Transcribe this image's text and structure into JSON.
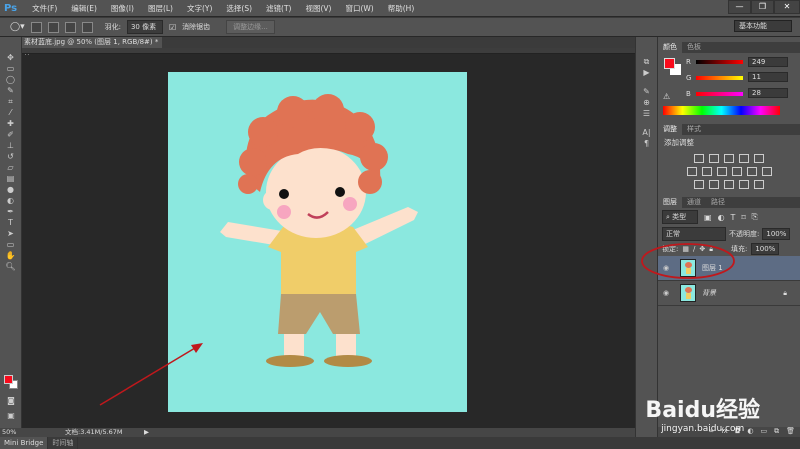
{
  "app": {
    "logo": "Ps"
  },
  "menu": [
    "文件(F)",
    "编辑(E)",
    "图像(I)",
    "图层(L)",
    "文字(Y)",
    "选择(S)",
    "滤镜(T)",
    "视图(V)",
    "窗口(W)",
    "帮助(H)"
  ],
  "window_controls": {
    "minimize": "—",
    "restore": "❐",
    "close": "✕"
  },
  "options": {
    "feather_label": "羽化:",
    "feather_value": "30 像素",
    "antialias_label": "消除锯齿",
    "antialias_checked": true,
    "refine_edge": "调整边缘...",
    "workspace": "基本功能"
  },
  "document": {
    "tab_title": "素材蓝底.jpg @ 50% (图层 1, RGB/8#) *",
    "close": "×"
  },
  "status": {
    "zoom": "50%",
    "doc_info": "文档:3.41M/5.67M"
  },
  "bottom_tabs": [
    "Mini Bridge",
    "时间轴"
  ],
  "color_panel": {
    "tabs": [
      "颜色",
      "色板"
    ],
    "foreground": "#f90b1c",
    "background": "#ffffff",
    "channels": [
      {
        "label": "R",
        "value": "249"
      },
      {
        "label": "G",
        "value": "11"
      },
      {
        "label": "B",
        "value": "28"
      }
    ]
  },
  "adjust_panel": {
    "tabs": [
      "调整",
      "样式"
    ],
    "title": "添加调整"
  },
  "layers_panel": {
    "tabs": [
      "图层",
      "通道",
      "路径"
    ],
    "filter": "类型",
    "blend_mode": "正常",
    "opacity_label": "不透明度:",
    "opacity": "100%",
    "lock_label": "锁定:",
    "fill_label": "填充:",
    "fill": "100%",
    "layers": [
      {
        "name": "图层 1",
        "selected": true,
        "locked": false
      },
      {
        "name": "背景",
        "selected": false,
        "locked": true
      }
    ]
  },
  "watermark": {
    "brand": "Baidu经验",
    "url": "jingyan.baidu.com"
  },
  "colors": {
    "annotation": "#c0181c",
    "canvas_bg": "#8be8df"
  }
}
